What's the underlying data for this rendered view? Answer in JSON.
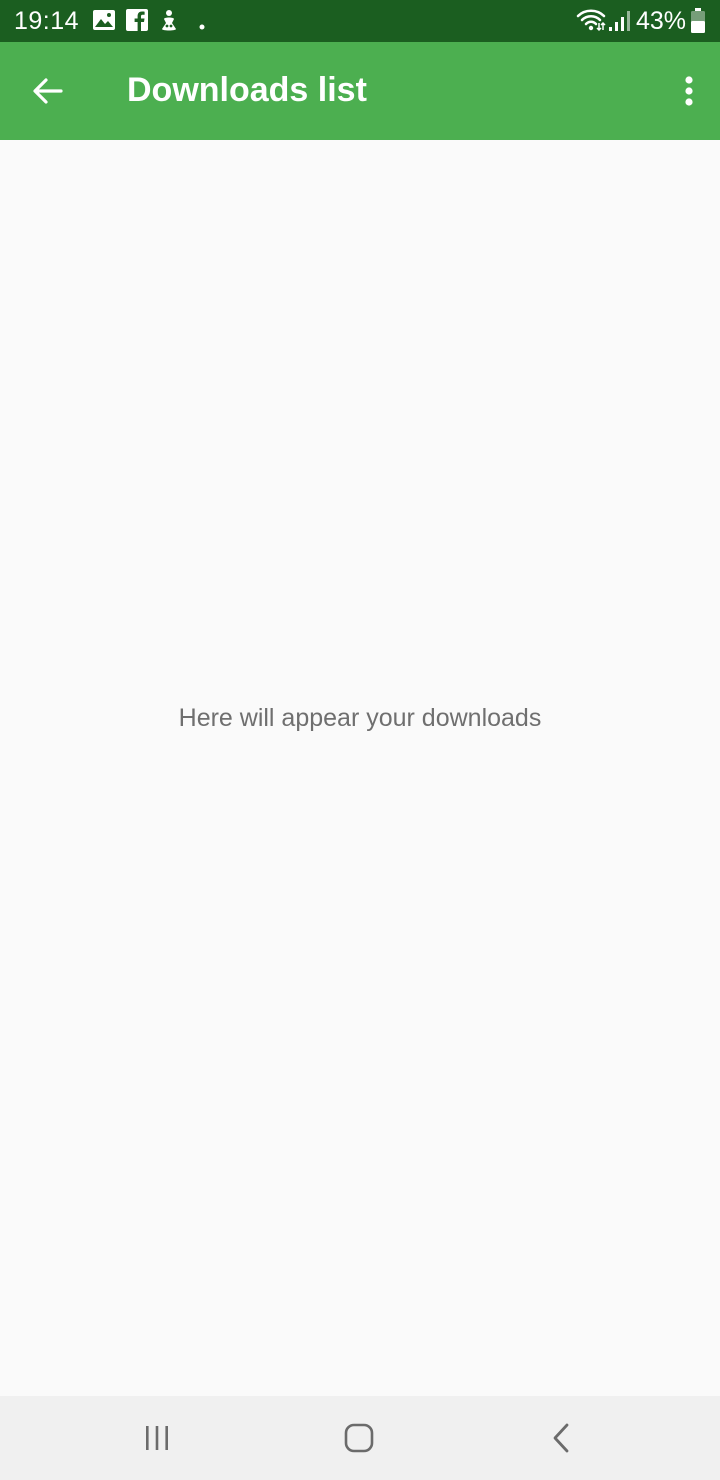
{
  "status_bar": {
    "time": "19:14",
    "battery": "43%",
    "background_color": "#1b5e20",
    "icons": [
      "gallery-icon",
      "facebook-icon",
      "notification-app-icon",
      "dot-icon",
      "wifi-icon",
      "signal-icon",
      "battery-icon"
    ]
  },
  "app_bar": {
    "title": "Downloads list",
    "background_color": "#4caf50",
    "back_icon": "arrow-left-icon",
    "menu_icon": "more-vert-icon"
  },
  "content": {
    "empty_message": "Here will appear your downloads"
  },
  "nav_bar": {
    "icons": [
      "recent-apps-icon",
      "home-icon",
      "back-icon"
    ]
  }
}
